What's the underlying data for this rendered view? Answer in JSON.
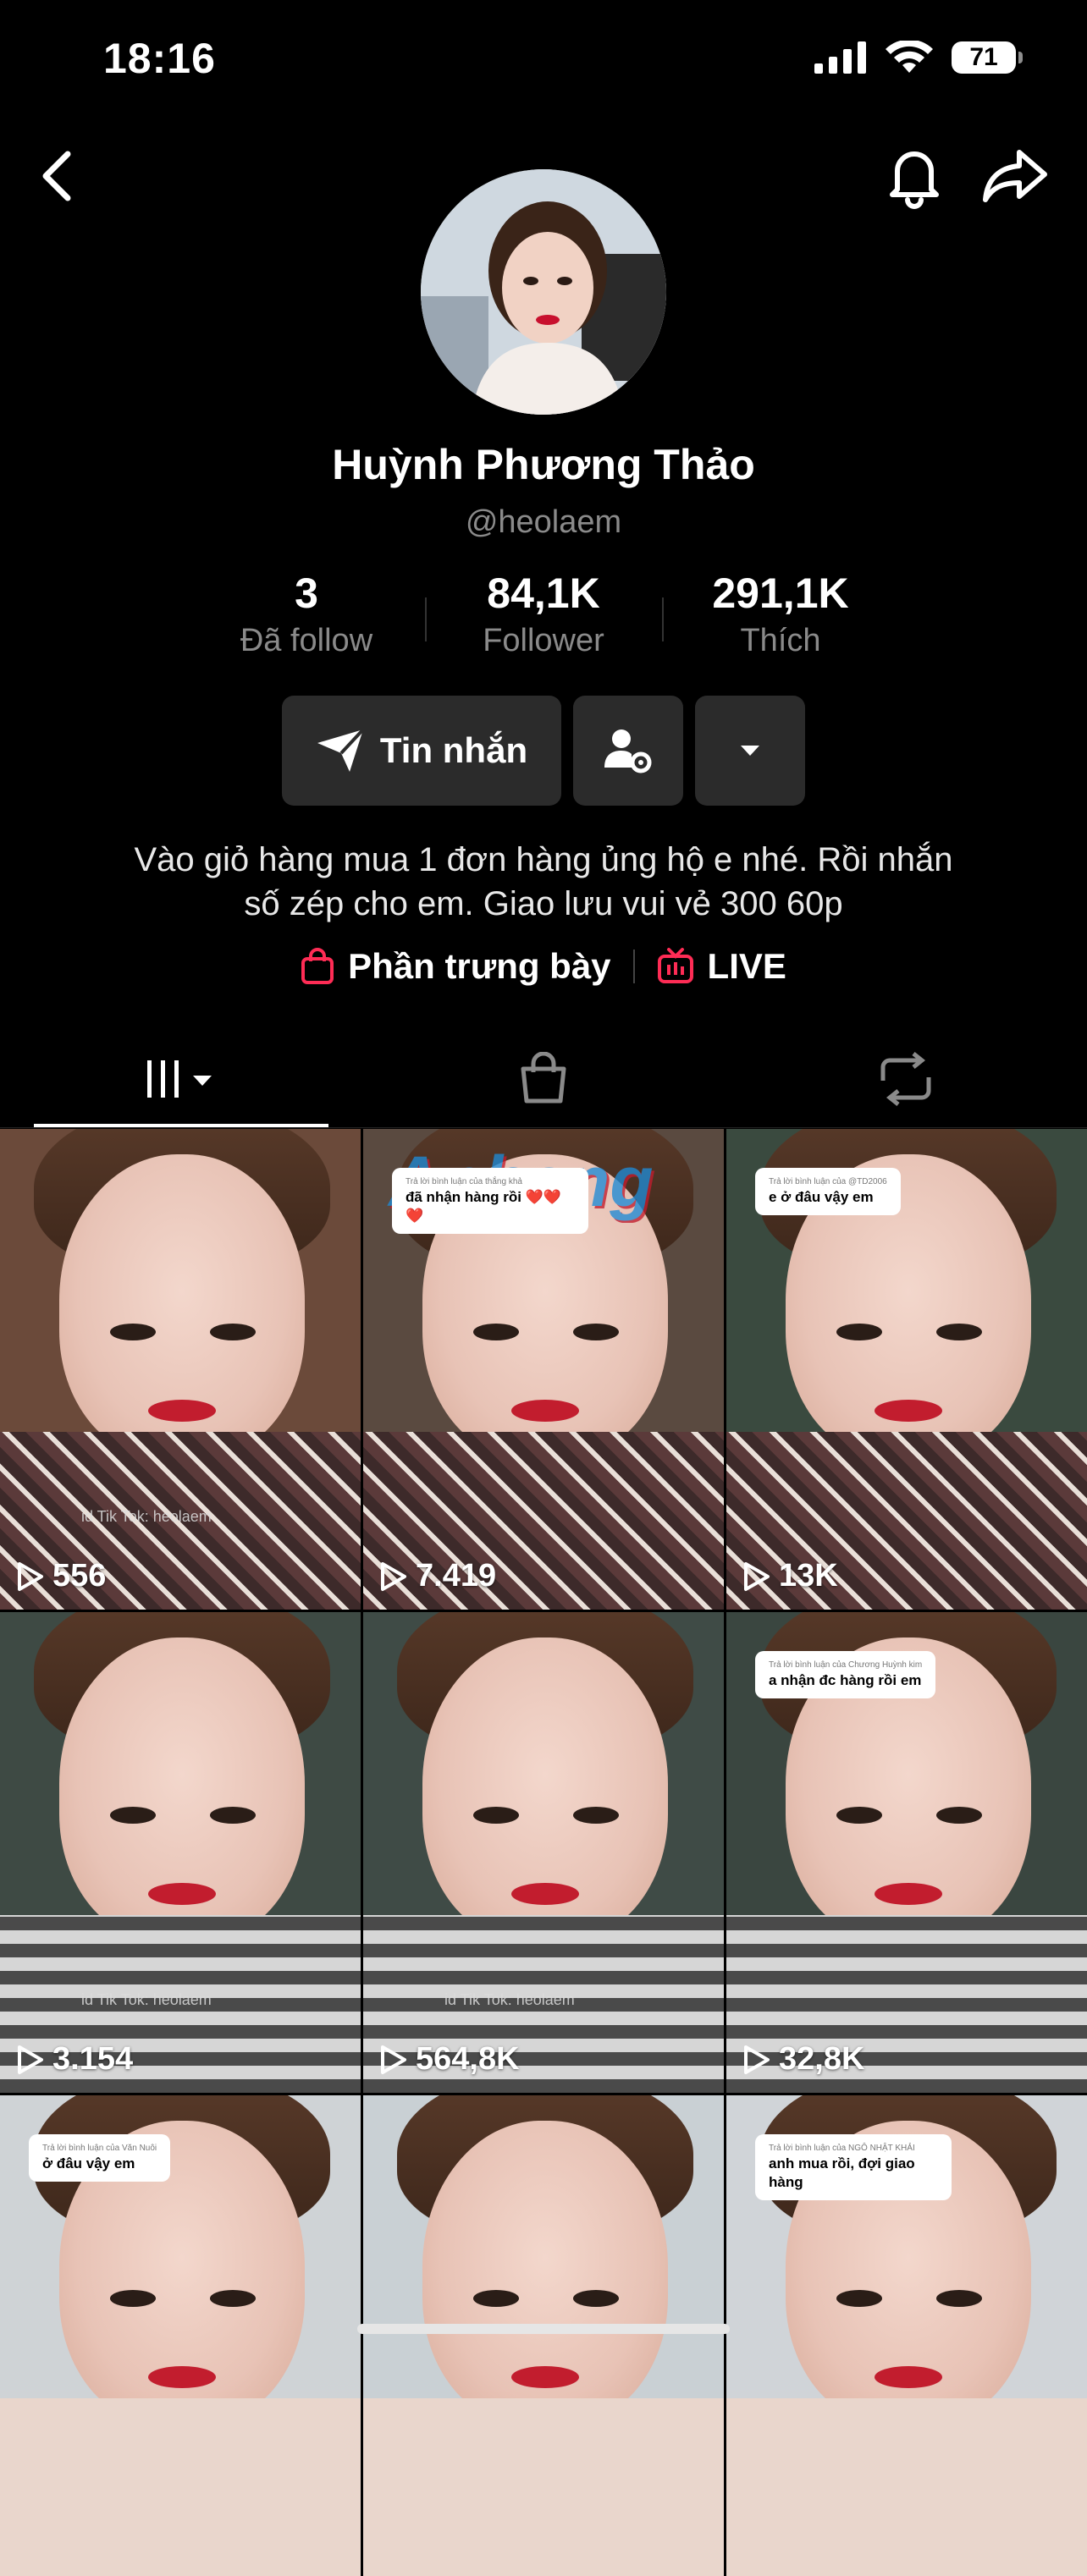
{
  "status_bar": {
    "time": "18:16",
    "battery": "71"
  },
  "profile": {
    "name": "Huỳnh Phương Thảo",
    "handle": "@heolaem",
    "stats": [
      {
        "value": "3",
        "label": "Đã follow"
      },
      {
        "value": "84,1K",
        "label": "Follower"
      },
      {
        "value": "291,1K",
        "label": "Thích"
      }
    ],
    "message_button": "Tin nhắn",
    "bio_line1": "Vào giỏ hàng mua 1 đơn hàng ủng hộ e nhé. Rồi nhắn",
    "bio_line2": "số zép cho em. Giao lưu vui vẻ 300 60p",
    "showcase_label": "Phần trưng bày",
    "live_label": "LIVE"
  },
  "colors": {
    "accent_red": "#fe2c55",
    "background": "#000000",
    "button_bg": "#2b2b2b"
  },
  "videos": [
    {
      "views": "556",
      "overlay": "id Tik Tok: heolaem"
    },
    {
      "views": "7.419",
      "logo": "Aphang",
      "caption_small": "Trả lời bình luận của thắng khả",
      "caption": "đã nhận hàng rồi ❤️❤️❤️"
    },
    {
      "views": "13K",
      "caption_small": "Trả lời bình luận của @TD2006",
      "caption": "e ở đâu vậy em"
    },
    {
      "views": "3.154",
      "overlay": "id Tik Tok: heolaem"
    },
    {
      "views": "564,8K",
      "overlay": "id Tik Tok: heolaem"
    },
    {
      "views": "32,8K",
      "caption_small": "Trả lời bình luận của Chương Huỳnh kim",
      "caption": "a nhận đc hàng rồi em"
    },
    {
      "views": "",
      "caption_small": "Trả lời bình luận của Văn Nuôi",
      "caption": "ở đâu vậy em"
    },
    {
      "views": ""
    },
    {
      "views": "",
      "caption_small": "Trả lời bình luận của NGÔ NHẬT KHẢI",
      "caption": "anh mua rồi, đợi giao hàng"
    }
  ]
}
